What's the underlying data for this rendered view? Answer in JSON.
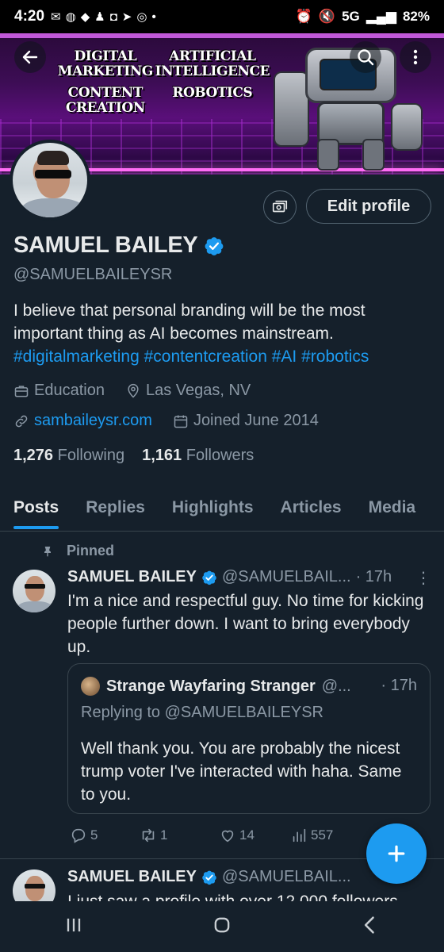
{
  "status_bar": {
    "time": "4:20",
    "network": "5G",
    "battery": "82%",
    "notification_icons": [
      "mail-icon",
      "whatsapp-icon",
      "chat-icon",
      "snapchat-icon",
      "instagram-icon",
      "telegram-icon",
      "signal-icon"
    ]
  },
  "banner": {
    "words": [
      "DIGITAL MARKETING",
      "ARTIFICIAL INTELLIGENCE",
      "CONTENT CREATION",
      "ROBOTICS"
    ]
  },
  "profile": {
    "display_name": "SAMUEL BAILEY",
    "handle": "@SAMUELBAILEYSR",
    "bio_text": "I believe that personal branding will be the most important thing as AI becomes mainstream.",
    "bio_tags": [
      "#digitalmarketing",
      "#contentcreation",
      "#AI",
      "#robotics"
    ],
    "category": "Education",
    "location": "Las Vegas, NV",
    "website": "sambaileysr.com",
    "joined": "Joined June 2014",
    "following_count": "1,276",
    "following_label": "Following",
    "followers_count": "1,161",
    "followers_label": "Followers",
    "edit_button": "Edit profile"
  },
  "tabs": [
    "Posts",
    "Replies",
    "Highlights",
    "Articles",
    "Media"
  ],
  "active_tab": "Posts",
  "pinned_label": "Pinned",
  "tweet": {
    "name": "SAMUEL BAILEY",
    "handle": "@SAMUELBAIL...",
    "time": "· 17h",
    "text": "I'm a nice and respectful guy. No time for kicking people further down. I want to bring everybody up.",
    "quote": {
      "name": "Strange Wayfaring Stranger",
      "handle": "@...",
      "time": "· 17h",
      "replying": "Replying to @SAMUELBAILEYSR",
      "text": "Well thank you. You are probably the nicest trump voter I've interacted with haha. Same to you."
    },
    "replies": "5",
    "reposts": "1",
    "likes": "14",
    "views": "557"
  },
  "next_tweet": {
    "name": "SAMUEL BAILEY",
    "handle": "@SAMUELBAIL...",
    "text_partial": "I just saw a profile with over 12,000 followers"
  },
  "colors": {
    "background": "#15202b",
    "accent": "#1d9bf0",
    "secondary_text": "#8b98a5",
    "border": "#38444d"
  }
}
